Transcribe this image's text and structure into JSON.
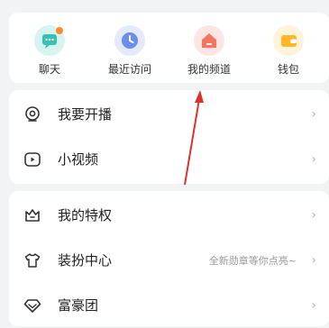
{
  "quick": [
    {
      "label": "聊天",
      "icon": "chat-bubble-icon",
      "bg": "#d8f4f1",
      "fg": "#33c2b4",
      "dot": "#ff8a2a"
    },
    {
      "label": "最近访问",
      "icon": "clock-icon",
      "bg": "#e4eafc",
      "fg": "#6b8df0"
    },
    {
      "label": "我的频道",
      "icon": "channel-house-icon",
      "bg": "#fde6e2",
      "fg": "#f57565"
    },
    {
      "label": "钱包",
      "icon": "wallet-icon",
      "bg": "#fff3d9",
      "fg": "#ffb62a"
    }
  ],
  "menu_group_1": [
    {
      "label": "我要开播",
      "icon": "live-camera-icon"
    },
    {
      "label": "小视频",
      "icon": "video-play-icon"
    }
  ],
  "menu_group_2": [
    {
      "label": "我的特权",
      "icon": "crown-bag-icon"
    },
    {
      "label": "装扮中心",
      "icon": "tshirt-icon",
      "hint": "全新勋章等你点亮~"
    },
    {
      "label": "富豪团",
      "icon": "diamond-icon"
    }
  ],
  "chevron": "›",
  "annotation_color": "#e0302a"
}
